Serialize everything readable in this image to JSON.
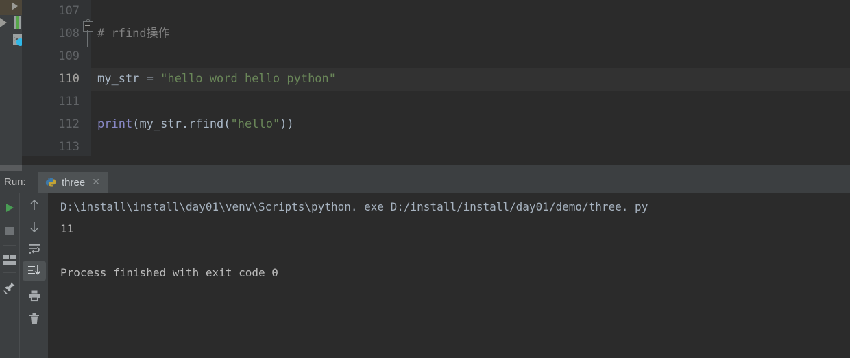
{
  "editor": {
    "lines": [
      {
        "number": "107",
        "tokens": []
      },
      {
        "number": "108",
        "tokens": [
          {
            "text": "# rfind操作",
            "type": "comment"
          }
        ]
      },
      {
        "number": "109",
        "tokens": []
      },
      {
        "number": "110",
        "tokens": [
          {
            "text": "my_str",
            "type": "var"
          },
          {
            "text": " = ",
            "type": "op"
          },
          {
            "text": "\"hello word hello python\"",
            "type": "string"
          }
        ]
      },
      {
        "number": "111",
        "tokens": []
      },
      {
        "number": "112",
        "tokens": [
          {
            "text": "print",
            "type": "builtin"
          },
          {
            "text": "(",
            "type": "op"
          },
          {
            "text": "my_str",
            "type": "var"
          },
          {
            "text": ".",
            "type": "op"
          },
          {
            "text": "rfind",
            "type": "func"
          },
          {
            "text": "(",
            "type": "op"
          },
          {
            "text": "\"hello\"",
            "type": "string"
          },
          {
            "text": "))",
            "type": "op"
          }
        ]
      },
      {
        "number": "113",
        "tokens": []
      }
    ],
    "line_texts": {
      "l107": "",
      "l108": "# rfind操作",
      "l109": "",
      "l110": "my_str = \"hello word hello python\"",
      "l111": "",
      "l112": "print(my_str.rfind(\"hello\"))",
      "l113": ""
    },
    "code_segments": {
      "l110_var": "my_str",
      "l110_eq": " = ",
      "l110_str": "\"hello word hello python\"",
      "l112_print": "print",
      "l112_open": "(",
      "l112_obj": "my_str",
      "l112_dot": ".",
      "l112_method": "rfind",
      "l112_open2": "(",
      "l112_arg": "\"hello\"",
      "l112_close": "))"
    },
    "current_line": "110",
    "colors": {
      "background": "#2b2b2b",
      "gutter": "#313335",
      "current_line_highlight": "#323232",
      "comment": "#808080",
      "string": "#6a8759",
      "keyword": "#8888c6",
      "default_text": "#a9b7c6",
      "line_number": "#606366",
      "line_number_current": "#a4a3a0"
    },
    "gutter_icons": {
      "run_top": "run-triangle-icon",
      "run_config": "run-triangle-icon",
      "running": "running-bars-icon",
      "console": "console-prompt-icon"
    }
  },
  "run_panel": {
    "label": "Run:",
    "tab": {
      "icon": "python-logo-icon",
      "title": "three",
      "close": "✕"
    },
    "toolbar_left": [
      {
        "name": "rerun-button",
        "icon": "play-triangle-icon",
        "label": "Rerun"
      },
      {
        "name": "stop-button",
        "icon": "stop-square-icon",
        "label": "Stop"
      },
      {
        "name": "restore-layout-button",
        "icon": "layout-icon",
        "label": "Restore Layout"
      },
      {
        "name": "pin-tab-button",
        "icon": "pin-icon",
        "label": "Pin Tab"
      }
    ],
    "toolbar_console": [
      {
        "name": "up-button",
        "icon": "arrow-up-icon",
        "label": "Up"
      },
      {
        "name": "down-button",
        "icon": "arrow-down-icon",
        "label": "Down"
      },
      {
        "name": "soft-wrap-button",
        "icon": "soft-wrap-icon",
        "label": "Soft-Wrap"
      },
      {
        "name": "scroll-to-end-button",
        "icon": "scroll-to-end-icon",
        "label": "Scroll to End",
        "active": true
      },
      {
        "name": "print-button",
        "icon": "printer-icon",
        "label": "Print"
      },
      {
        "name": "clear-all-button",
        "icon": "trash-icon",
        "label": "Clear All"
      }
    ],
    "console": {
      "command": "D:\\install\\install\\day01\\venv\\Scripts\\python. exe D:/install/install/day01/demo/three. py",
      "output": "11",
      "finished": "Process finished with exit code 0"
    }
  }
}
